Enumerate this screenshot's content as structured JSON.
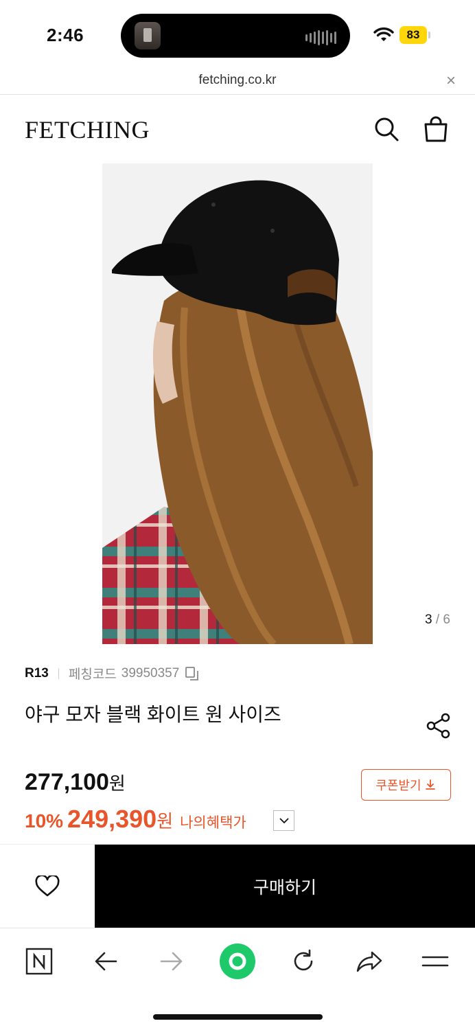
{
  "status": {
    "time": "2:46",
    "battery": "83"
  },
  "browser": {
    "url": "fetching.co.kr",
    "close_symbol": "×"
  },
  "header": {
    "logo": "FETCHING"
  },
  "gallery": {
    "current": "3",
    "separator": "/",
    "total": "6"
  },
  "product": {
    "brand": "R13",
    "code_label": "페칭코드",
    "code_value": "39950357",
    "title": "야구 모자 블랙 화이트 원 사이즈",
    "original_price": "277,100",
    "currency": "원",
    "discount": "10%",
    "sale_price": "249,390",
    "benefit_label": "나의혜택가",
    "coupon_label": "쿠폰받기"
  },
  "actions": {
    "buy_label": "구매하기"
  },
  "colors": {
    "accent": "#e8552a",
    "buy_bg": "#000000",
    "battery": "#ffd60a",
    "toolbar_green": "#1ec96a"
  },
  "icons": [
    "search-icon",
    "shopping-bag-icon",
    "copy-icon",
    "share-icon",
    "download-icon",
    "chevron-down-icon",
    "heart-icon",
    "naver-n-icon",
    "back-arrow-icon",
    "forward-arrow-icon",
    "green-dot-icon",
    "reload-icon",
    "share-arrow-icon",
    "menu-icon"
  ]
}
